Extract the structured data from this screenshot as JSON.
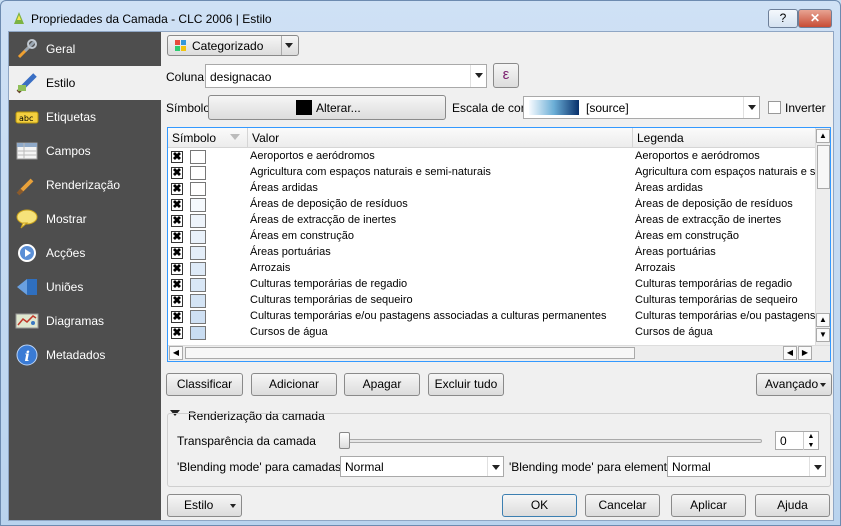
{
  "window": {
    "title": "Propriedades da Camada - CLC 2006 | Estilo",
    "help_label": "?",
    "close_label": "✕"
  },
  "sidebar": {
    "items": [
      {
        "label": "Geral",
        "icon": "tools-icon"
      },
      {
        "label": "Estilo",
        "icon": "paintbrush-icon"
      },
      {
        "label": "Etiquetas",
        "icon": "abc-label-icon"
      },
      {
        "label": "Campos",
        "icon": "table-fields-icon"
      },
      {
        "label": "Renderização",
        "icon": "brush-icon"
      },
      {
        "label": "Mostrar",
        "icon": "speech-bubble-icon"
      },
      {
        "label": "Acções",
        "icon": "gear-action-icon"
      },
      {
        "label": "Uniões",
        "icon": "join-icon"
      },
      {
        "label": "Diagramas",
        "icon": "diagram-icon"
      },
      {
        "label": "Metadados",
        "icon": "info-icon"
      }
    ]
  },
  "style": {
    "renderer_value": "Categorizado",
    "column_label": "Coluna",
    "column_value": "designacao",
    "expression_button": "ε",
    "symbol_label": "Símbolo",
    "change_button": "Alterar...",
    "color_ramp_label": "Escala de cor",
    "color_ramp_value": "[source]",
    "invert_label": "Inverter",
    "invert_checked": false
  },
  "table": {
    "headers": [
      "Símbolo",
      "Valor",
      "Legenda"
    ],
    "rows": [
      {
        "checked": true,
        "color": "#ffffff",
        "value": "Aeroportos e aeródromos",
        "legend": "Aeroportos e aeródromos"
      },
      {
        "checked": true,
        "color": "#ffffff",
        "value": "Agricultura com espaços naturais e semi-naturais",
        "legend": "Agricultura com espaços naturais e semi-naturais"
      },
      {
        "checked": true,
        "color": "#ffffff",
        "value": "Áreas ardidas",
        "legend": "Áreas ardidas"
      },
      {
        "checked": true,
        "color": "#f5f9fd",
        "value": "Áreas de deposição de resíduos",
        "legend": "Áreas de deposição de resíduos"
      },
      {
        "checked": true,
        "color": "#eef4fb",
        "value": "Áreas de extracção de inertes",
        "legend": "Áreas de extracção de inertes"
      },
      {
        "checked": true,
        "color": "#e9f1fa",
        "value": "Áreas em construção",
        "legend": "Áreas em construção"
      },
      {
        "checked": true,
        "color": "#e4eef9",
        "value": "Áreas portuárias",
        "legend": "Áreas portuárias"
      },
      {
        "checked": true,
        "color": "#deeaf7",
        "value": "Arrozais",
        "legend": "Arrozais"
      },
      {
        "checked": true,
        "color": "#d9e7f6",
        "value": "Culturas temporárias de regadio",
        "legend": "Culturas temporárias de regadio"
      },
      {
        "checked": true,
        "color": "#d4e4f5",
        "value": "Culturas temporárias de sequeiro",
        "legend": "Culturas temporárias de sequeiro"
      },
      {
        "checked": true,
        "color": "#cfe0f3",
        "value": "Culturas temporárias e/ou pastagens associadas a culturas permanentes",
        "legend": "Culturas temporárias e/ou pastagens associadas a culturas permanentes"
      },
      {
        "checked": true,
        "color": "#c9ddf2",
        "value": "Cursos de água",
        "legend": "Cursos de água"
      }
    ]
  },
  "actions": {
    "classify": "Classificar",
    "add": "Adicionar",
    "delete": "Apagar",
    "delete_all": "Excluir tudo",
    "advanced": "Avançado"
  },
  "layer_rendering": {
    "title": "Renderização da camada",
    "transparency_label": "Transparência da camada",
    "transparency_value": "0",
    "layer_blend_label": "'Blending mode' para camadas",
    "layer_blend_value": "Normal",
    "feature_blend_label": "'Blending mode' para elementos",
    "feature_blend_value": "Normal"
  },
  "footer": {
    "style_button": "Estilo",
    "ok": "OK",
    "cancel": "Cancelar",
    "apply": "Aplicar",
    "help": "Ajuda"
  },
  "colors": {
    "sidebar_bg": "#4e4e4e",
    "focus_border": "#3399ff",
    "ramp_dark": "#1f5aa6"
  }
}
